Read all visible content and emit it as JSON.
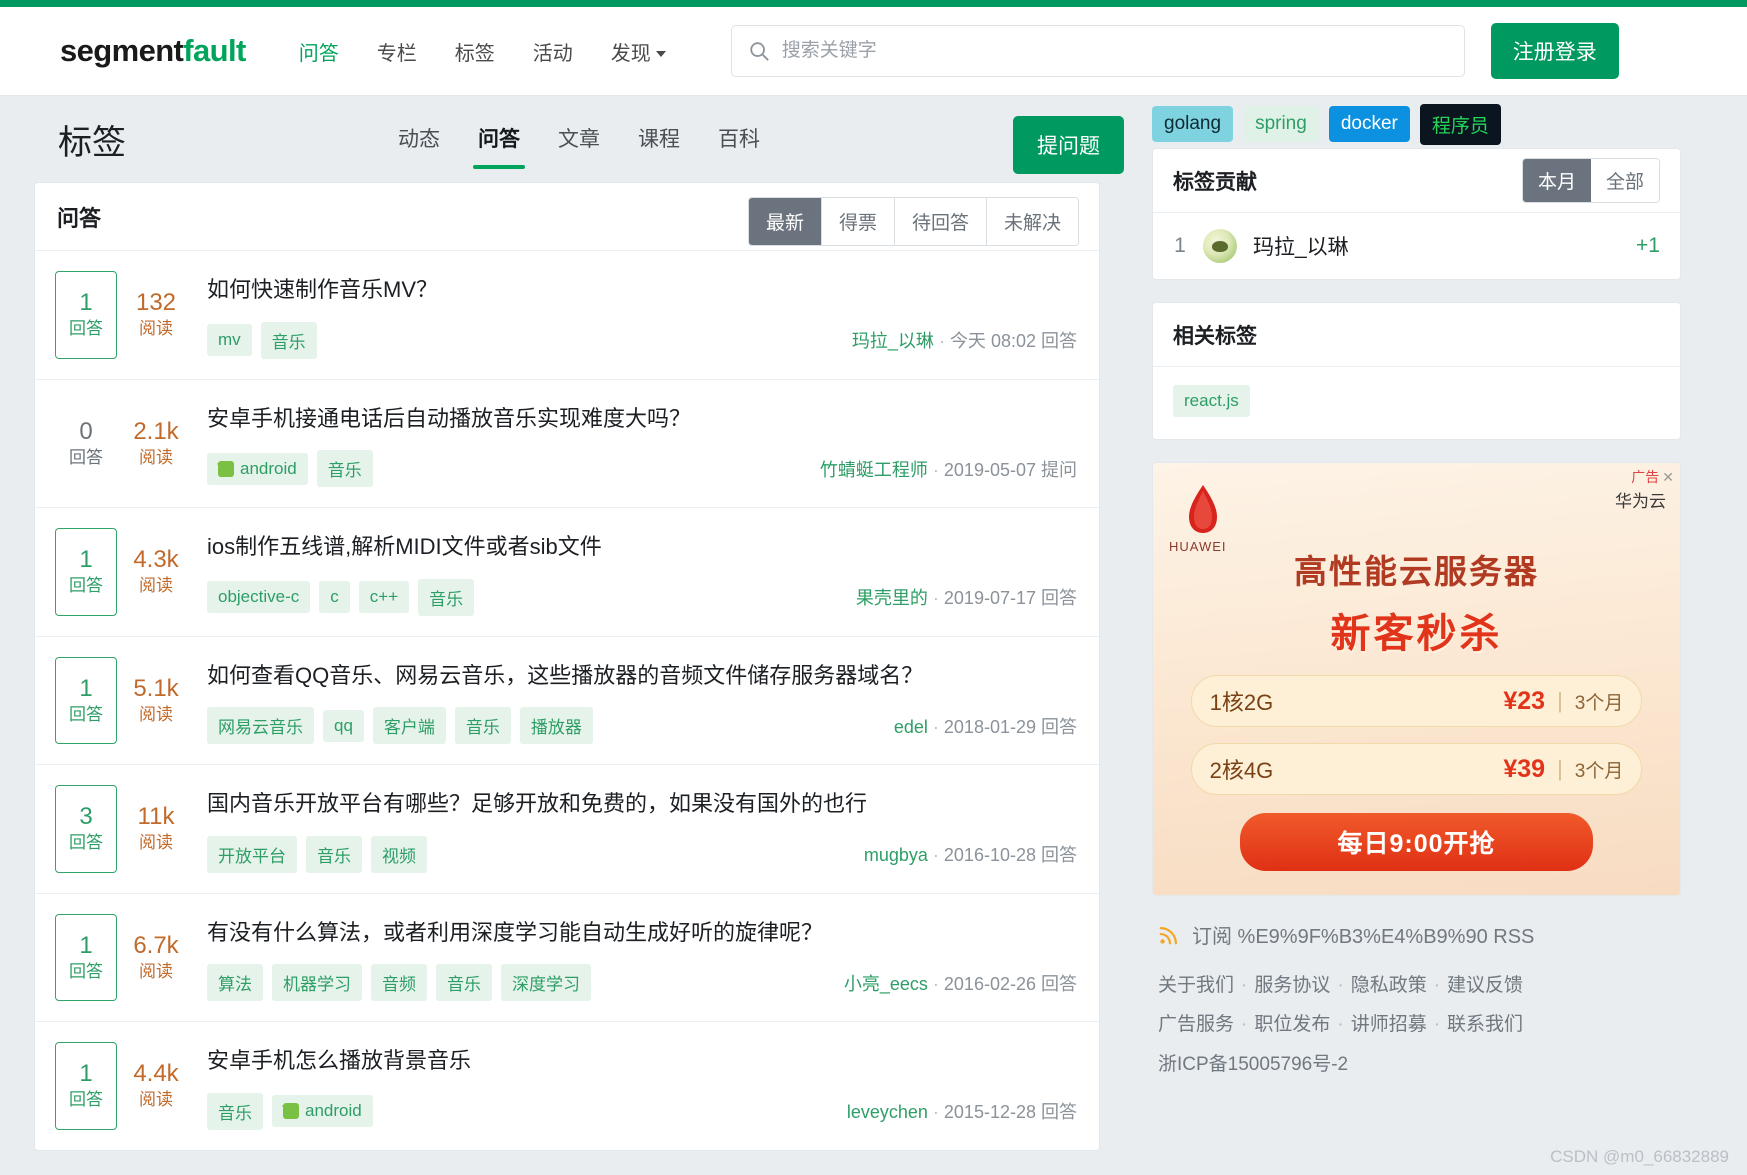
{
  "header": {
    "logo_seg": "segment",
    "logo_fault": "fault",
    "nav": [
      {
        "label": "问答",
        "active": true
      },
      {
        "label": "专栏",
        "active": false
      },
      {
        "label": "标签",
        "active": false
      },
      {
        "label": "活动",
        "active": false
      },
      {
        "label": "发现",
        "active": false,
        "caret": true
      }
    ],
    "search": {
      "placeholder": "搜索关键字",
      "value": "",
      "icon": "search-icon"
    },
    "login_label": "注册登录"
  },
  "page": {
    "title": "标签",
    "tabs": [
      {
        "label": "动态",
        "active": false
      },
      {
        "label": "问答",
        "active": true
      },
      {
        "label": "文章",
        "active": false
      },
      {
        "label": "课程",
        "active": false
      },
      {
        "label": "百科",
        "active": false
      }
    ],
    "ask_label": "提问题"
  },
  "list": {
    "heading": "问答",
    "sorts": [
      {
        "label": "最新",
        "active": true
      },
      {
        "label": "得票",
        "active": false
      },
      {
        "label": "待回答",
        "active": false
      },
      {
        "label": "未解决",
        "active": false
      }
    ],
    "answer_label": "回答",
    "read_label": "阅读",
    "questions": [
      {
        "answers": "1",
        "answered": true,
        "views": "132",
        "title": "如何快速制作音乐MV？",
        "tags": [
          {
            "label": "mv"
          },
          {
            "label": "音乐"
          }
        ],
        "author": "玛拉_以琳",
        "date": "今天 08:02",
        "action": "回答"
      },
      {
        "answers": "0",
        "answered": false,
        "views": "2.1k",
        "title": "安卓手机接通电话后自动播放音乐实现难度大吗？",
        "tags": [
          {
            "label": "android",
            "icon": "android-icon"
          },
          {
            "label": "音乐"
          }
        ],
        "author": "竹蜻蜓工程师",
        "date": "2019-05-07",
        "action": "提问"
      },
      {
        "answers": "1",
        "answered": true,
        "views": "4.3k",
        "title": "ios制作五线谱,解析MIDI文件或者sib文件",
        "tags": [
          {
            "label": "objective-c"
          },
          {
            "label": "c"
          },
          {
            "label": "c++"
          },
          {
            "label": "音乐"
          }
        ],
        "author": "果壳里的",
        "date": "2019-07-17",
        "action": "回答"
      },
      {
        "answers": "1",
        "answered": true,
        "views": "5.1k",
        "title": "如何查看QQ音乐、网易云音乐，这些播放器的音频文件储存服务器域名？",
        "tags": [
          {
            "label": "网易云音乐"
          },
          {
            "label": "qq"
          },
          {
            "label": "客户端"
          },
          {
            "label": "音乐"
          },
          {
            "label": "播放器"
          }
        ],
        "author": "edel",
        "date": "2018-01-29",
        "action": "回答"
      },
      {
        "answers": "3",
        "answered": true,
        "views": "11k",
        "title": "国内音乐开放平台有哪些？足够开放和免费的，如果没有国外的也行",
        "tags": [
          {
            "label": "开放平台"
          },
          {
            "label": "音乐"
          },
          {
            "label": "视频"
          }
        ],
        "author": "mugbya",
        "date": "2016-10-28",
        "action": "回答"
      },
      {
        "answers": "1",
        "answered": true,
        "views": "6.7k",
        "title": "有没有什么算法，或者利用深度学习能自动生成好听的旋律呢？",
        "tags": [
          {
            "label": "算法"
          },
          {
            "label": "机器学习"
          },
          {
            "label": "音频"
          },
          {
            "label": "音乐"
          },
          {
            "label": "深度学习"
          }
        ],
        "author": "小亮_eecs",
        "date": "2016-02-26",
        "action": "回答"
      },
      {
        "answers": "1",
        "answered": true,
        "views": "4.4k",
        "title": "安卓手机怎么播放背景音乐",
        "tags": [
          {
            "label": "音乐"
          },
          {
            "label": "android",
            "icon": "android-icon"
          }
        ],
        "author": "leveychen",
        "date": "2015-12-28",
        "action": "回答"
      }
    ]
  },
  "sidebar": {
    "top_tags": [
      {
        "label": "golang",
        "style": "golang"
      },
      {
        "label": "spring",
        "style": "spring"
      },
      {
        "label": "docker",
        "style": "docker"
      },
      {
        "label": "程序员",
        "style": "coder"
      }
    ],
    "contribution": {
      "title": "标签贡献",
      "toggle": [
        {
          "label": "本月",
          "active": true
        },
        {
          "label": "全部",
          "active": false
        }
      ],
      "rows": [
        {
          "rank": "1",
          "name": "玛拉_以琳",
          "score": "+1"
        }
      ]
    },
    "related": {
      "title": "相关标签",
      "tags": [
        {
          "label": "react.js"
        }
      ]
    },
    "ad": {
      "label": "广告",
      "close": "✕",
      "brand": "华为云",
      "logo_text": "HUAWEI",
      "headline1": "高性能云服务器",
      "headline2": "新客秒杀",
      "specs": [
        {
          "name": "1核2G",
          "price": "¥23",
          "sep": "|",
          "term": "3个月"
        },
        {
          "name": "2核4G",
          "price": "¥39",
          "sep": "|",
          "term": "3个月"
        }
      ],
      "cta": "每日9:00开抢"
    },
    "rss": {
      "icon": "rss-icon",
      "text": "订阅 %E9%9F%B3%E4%B9%90 RSS"
    },
    "footer_links": [
      [
        "关于我们",
        "服务协议",
        "隐私政策",
        "建议反馈"
      ],
      [
        "广告服务",
        "职位发布",
        "讲师招募",
        "联系我们"
      ]
    ],
    "icp": "浙ICP备15005796号-2",
    "watermark": "CSDN @m0_66832889"
  }
}
